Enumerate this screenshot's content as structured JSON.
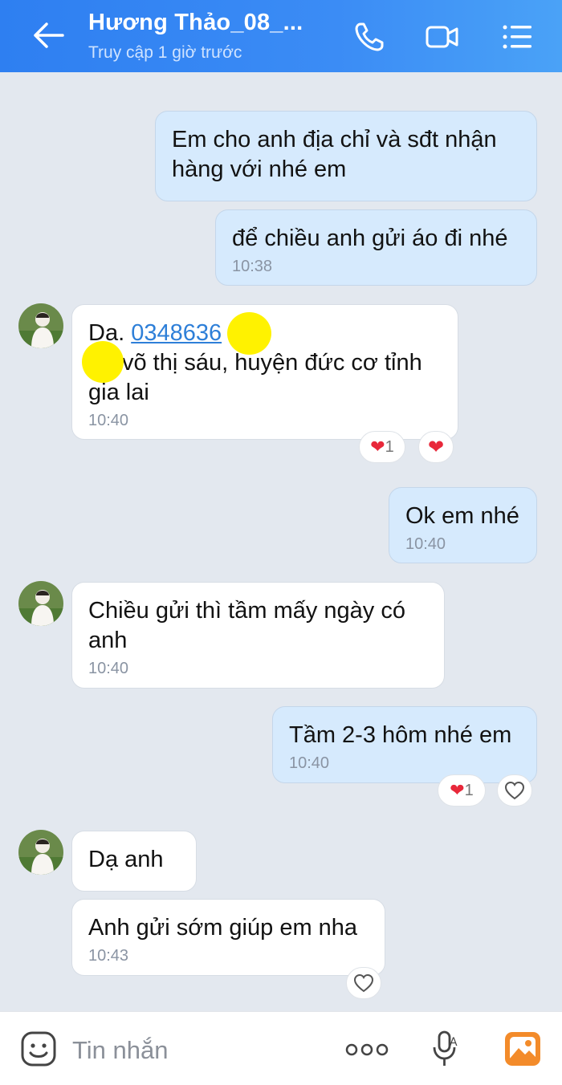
{
  "header": {
    "title": "Hương Thảo_08_...",
    "subtitle": "Truy cập 1 giờ trước"
  },
  "messages": [
    {
      "text": "Em cho anh địa chỉ và sđt nhận hàng với nhé em"
    },
    {
      "text": "để chiều anh gửi áo đi nhé",
      "time": "10:38"
    },
    {
      "prefix": "Da. ",
      "phone": "0348636",
      "rest": "võ thị sáu, huyện đức cơ tỉnh gia lai",
      "time": "10:40"
    },
    {
      "text": "Ok em nhé",
      "time": "10:40"
    },
    {
      "text": "Chiều gửi thì tầm mấy ngày có anh",
      "time": "10:40"
    },
    {
      "text": "Tầm 2-3 hôm nhé em",
      "time": "10:40"
    },
    {
      "text": "Dạ anh"
    },
    {
      "text": "Anh gửi sớm giúp em nha",
      "time": "10:43"
    }
  ],
  "reactions": {
    "r1_count": "1",
    "r2_count": "1"
  },
  "composer": {
    "placeholder": "Tin nhắn"
  },
  "colors": {
    "header": "#2e7ff1",
    "sent_bubble": "#d6eafd",
    "received_bubble": "#ffffff",
    "background": "#e3e8ef",
    "heart": "#e8283a"
  }
}
